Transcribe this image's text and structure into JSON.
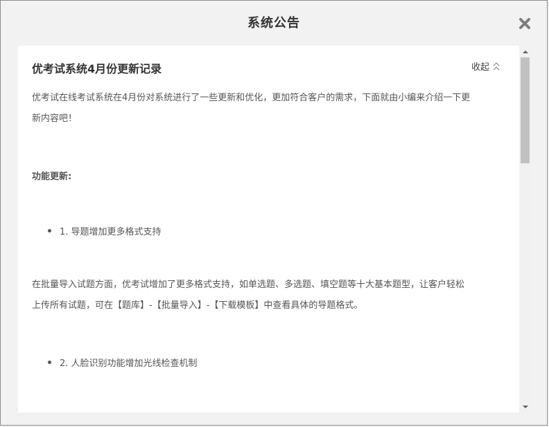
{
  "dialog": {
    "title": "系统公告",
    "close_icon": "close-icon"
  },
  "article": {
    "title": "优考试系统4月份更新记录",
    "collapse_label": "收起",
    "collapse_icon": "chevron-up-double-icon",
    "intro_line1": "优考试在线考试系统在4月份对系统进行了一些更新和优化，更加符合客户的需求，下面就由小编来介绍一下更",
    "intro_line2": "新内容吧！",
    "section_title": "功能更新:",
    "items": [
      {
        "label": "1. 导题增加更多格式支持"
      },
      {
        "label": "2. 人脸识别功能增加光线检查机制"
      }
    ],
    "item1_desc_line1": "在批量导入试题方面，优考试增加了更多格式支持，如单选题、多选题、填空题等十大基本题型，让客户轻松",
    "item1_desc_line2": "上传所有试题，可在【题库】-【批量导入】-【下载模板】中查看具体的导题格式。"
  },
  "scrollbar": {
    "up_icon": "scroll-up-arrow-icon",
    "down_icon": "scroll-down-arrow-icon",
    "position": 0.0
  },
  "colors": {
    "background": "#f2f2f2",
    "panel": "#ffffff",
    "text": "#555555",
    "title": "#333333",
    "scroll_thumb": "#c1c1c1"
  }
}
